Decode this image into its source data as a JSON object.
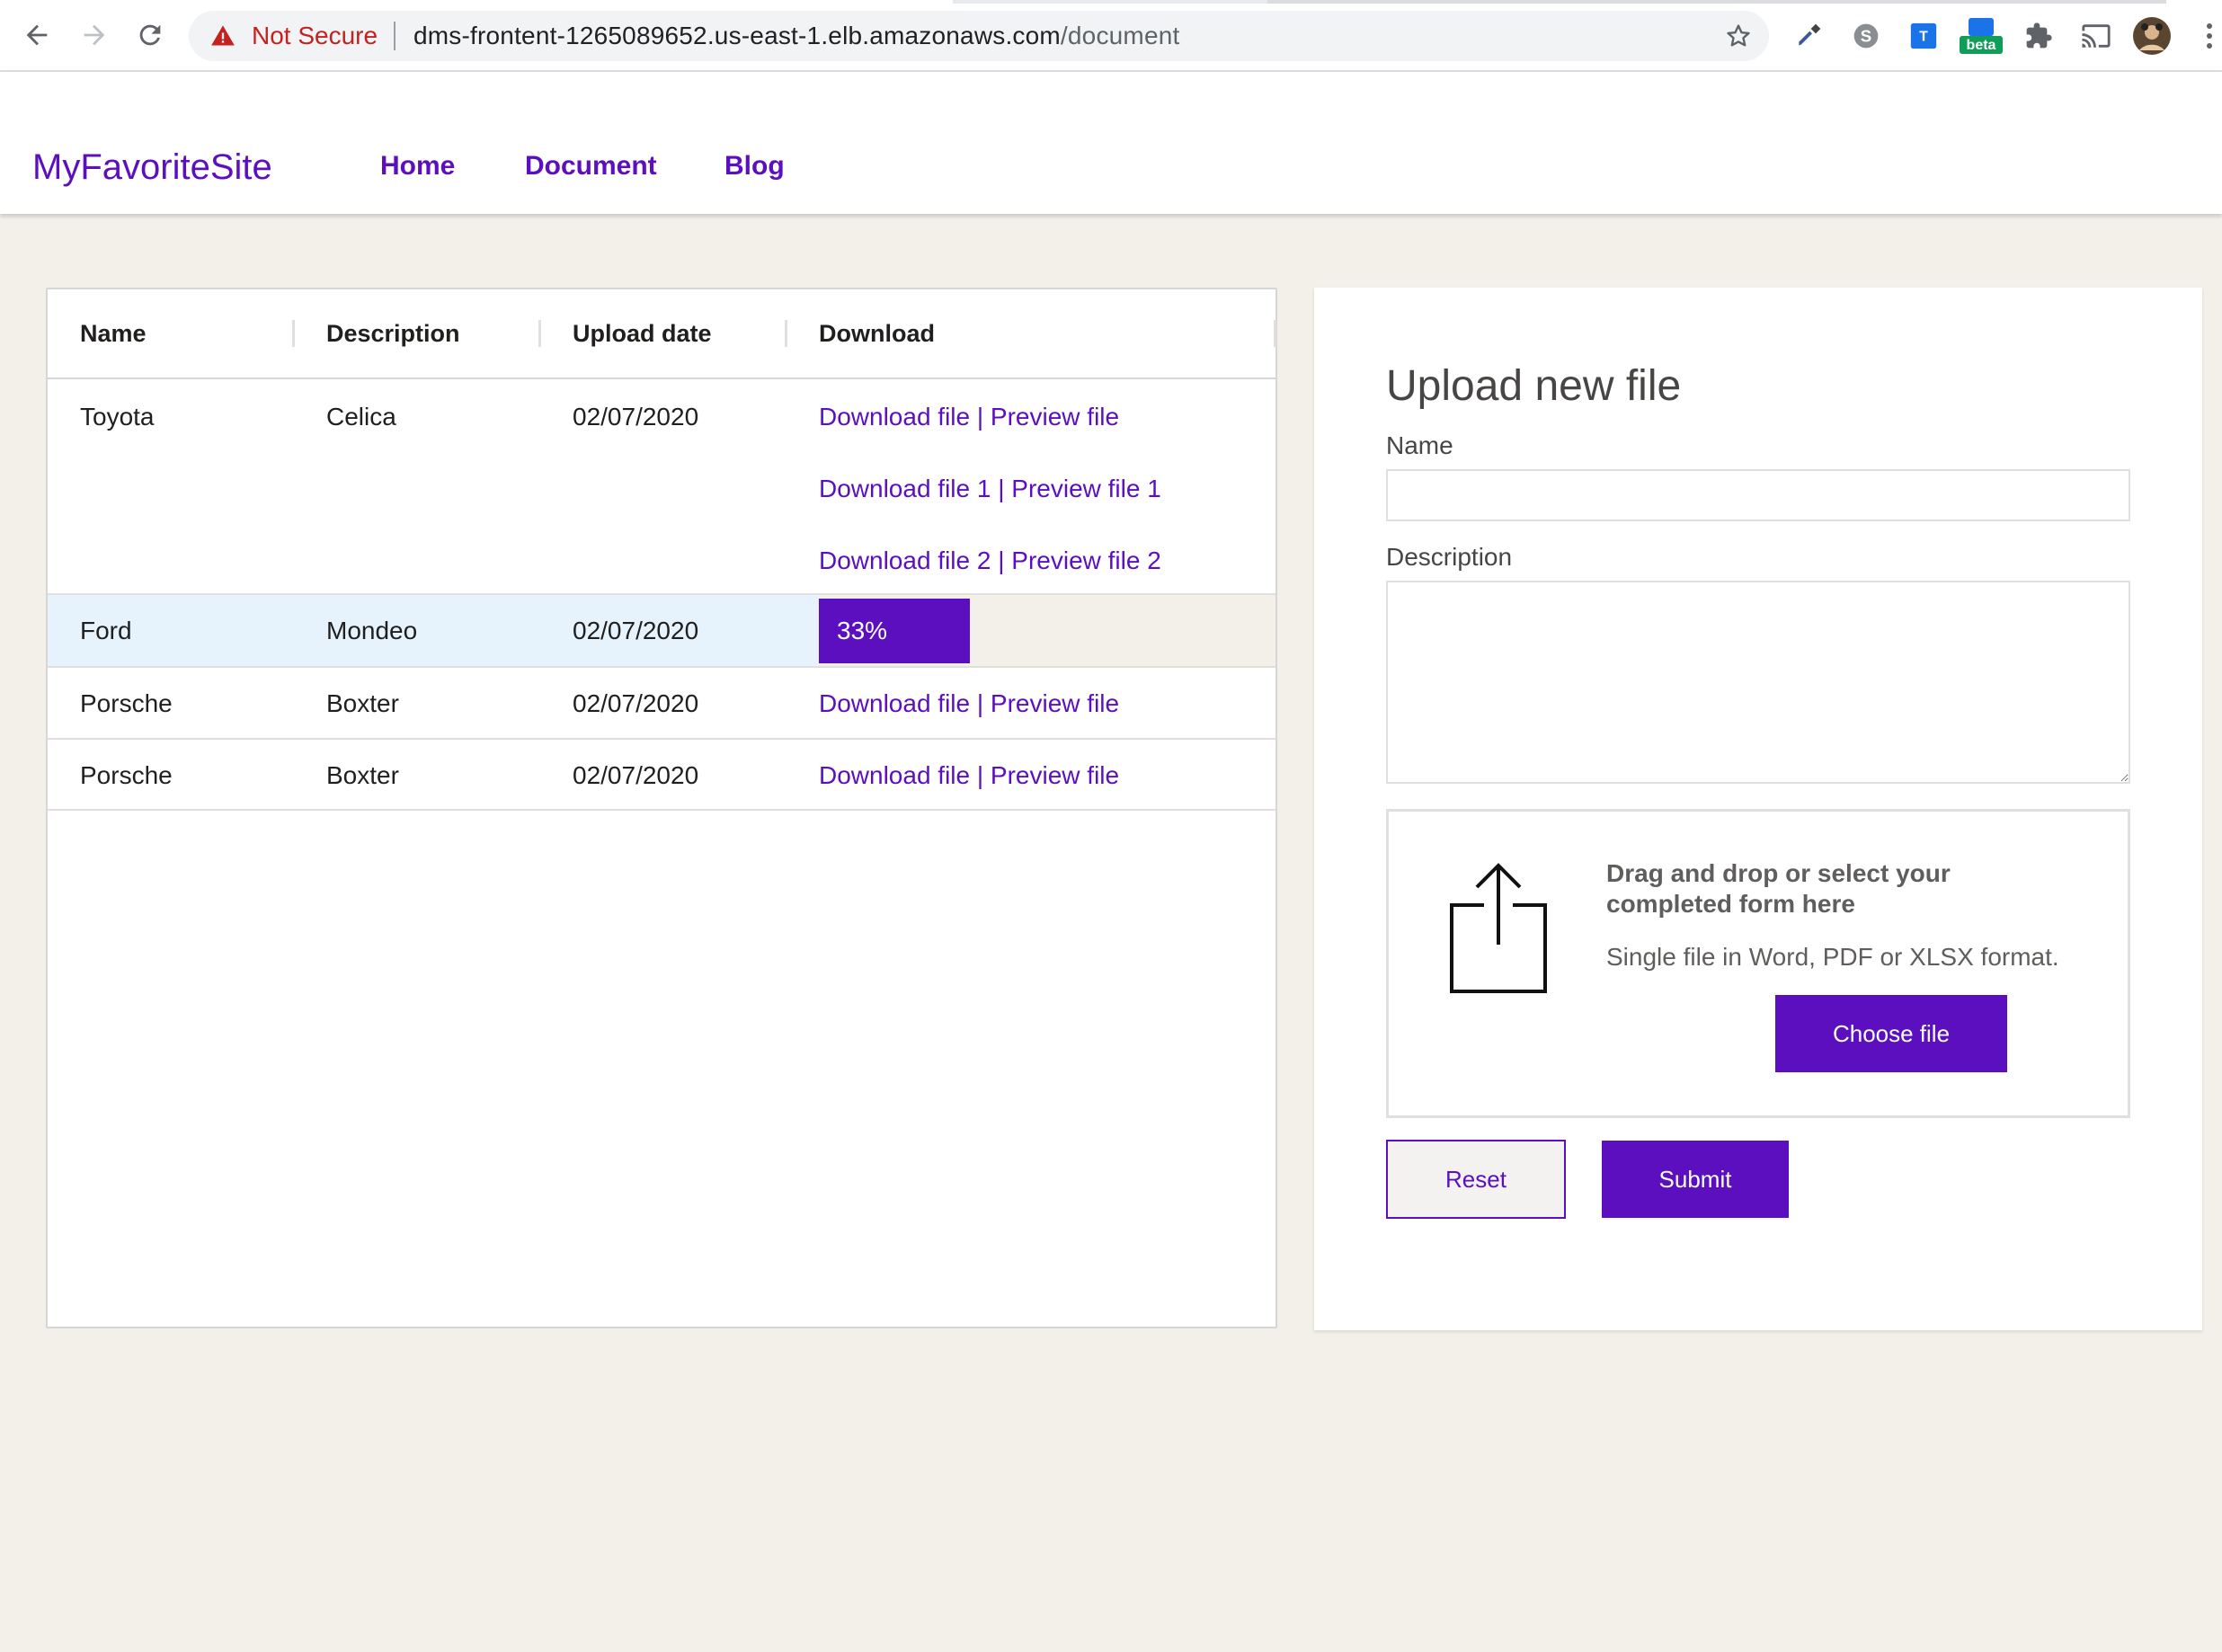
{
  "browser": {
    "security_label": "Not Secure",
    "url_host": "dms-frontent-1265089652.us-east-1.elb.amazonaws.com",
    "url_path": "/document",
    "beta_badge": "beta",
    "icons": [
      "back-arrow-icon",
      "forward-arrow-icon",
      "reload-icon",
      "warning-icon",
      "star-icon",
      "eyedropper-icon",
      "skype-icon",
      "translate-icon",
      "beta-extension-icon",
      "puzzle-extensions-icon",
      "cast-icon",
      "profile-avatar-icon",
      "kebab-menu-icon"
    ]
  },
  "header": {
    "brand": "MyFavoriteSite",
    "nav": [
      {
        "label": "Home"
      },
      {
        "label": "Document"
      },
      {
        "label": "Blog"
      }
    ]
  },
  "table": {
    "columns": [
      "Name",
      "Description",
      "Upload date",
      "Download"
    ],
    "rows": [
      {
        "name": "Toyota",
        "description": "Celica",
        "date": "02/07/2020",
        "links": [
          "Download file | Preview file",
          "Download file 1 | Preview file 1",
          "Download file 2 | Preview file 2"
        ]
      },
      {
        "name": "Ford",
        "description": "Mondeo",
        "date": "02/07/2020",
        "progress": "33%",
        "progress_value": 33,
        "selected": true
      },
      {
        "name": "Porsche",
        "description": "Boxter",
        "date": "02/07/2020",
        "links": [
          "Download file | Preview file"
        ]
      },
      {
        "name": "Porsche",
        "description": "Boxter",
        "date": "02/07/2020",
        "links": [
          "Download file | Preview file"
        ]
      }
    ]
  },
  "upload": {
    "title": "Upload new file",
    "name_label": "Name",
    "name_value": "",
    "description_label": "Description",
    "description_value": "",
    "dropzone_title": "Drag and drop or select your completed form here",
    "dropzone_subtitle": "Single file in Word, PDF or XLSX format.",
    "choose_label": "Choose file",
    "reset_label": "Reset",
    "submit_label": "Submit",
    "upload_icon": "share-upload-icon"
  },
  "colors": {
    "accent": "#5c0fbf",
    "page_bg": "#f3f0ea",
    "selected_row": "#e6f3fc",
    "warning": "#c5221f"
  }
}
